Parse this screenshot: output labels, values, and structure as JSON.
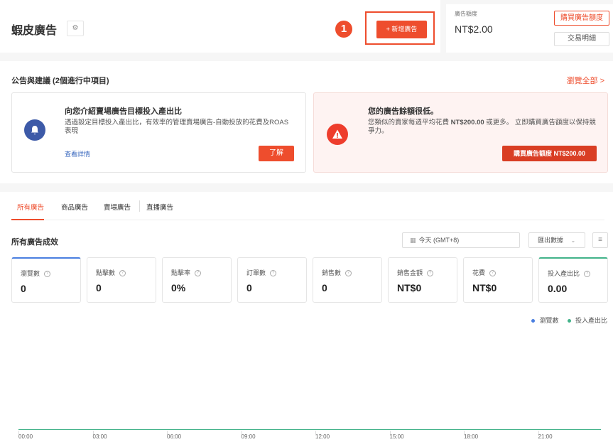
{
  "header": {
    "title": "蝦皮廣告",
    "gear_icon": "gear-icon",
    "step_number": "1",
    "create_button": "+ 新增廣告"
  },
  "budget": {
    "label": "廣告額度",
    "value": "NT$2.00",
    "buy_button": "購買廣告額度",
    "transactions_button": "交易明細"
  },
  "announcements": {
    "title": "公告與建議 (2個進行中項目)",
    "view_all": "瀏覽全部 >",
    "cards": [
      {
        "icon": "bell-icon",
        "heading": "向您介紹賣場廣告目標投入產出比",
        "desc": "透過設定目標投入產出比，有效率的管理賣場廣告-自動投放的花費及ROAS表現",
        "link": "查看詳情",
        "button": "了解"
      },
      {
        "icon": "warning-icon",
        "heading": "您的廣告餘額很低。",
        "desc_prefix": "您類似的賣家每週平均花費 ",
        "desc_amount": "NT$200.00",
        "desc_suffix": " 或更多。 立即購買廣告額度以保持競爭力。",
        "button": "購買廣告額度 NT$200.00"
      }
    ]
  },
  "tabs": [
    "所有廣告",
    "商品廣告",
    "賣場廣告",
    "直播廣告"
  ],
  "performance": {
    "title": "所有廣告成效",
    "date_range": "今天 (GMT+8)",
    "export": "匯出數據",
    "metrics": [
      {
        "label": "瀏覽數",
        "value": "0"
      },
      {
        "label": "點擊數",
        "value": "0"
      },
      {
        "label": "點擊率",
        "value": "0%"
      },
      {
        "label": "訂單數",
        "value": "0"
      },
      {
        "label": "銷售數",
        "value": "0"
      },
      {
        "label": "銷售金額",
        "value": "NT$0"
      },
      {
        "label": "花費",
        "value": "NT$0"
      },
      {
        "label": "投入產出比",
        "value": "0.00"
      }
    ],
    "legend": [
      {
        "name": "瀏覽數",
        "color": "#4a7fe0"
      },
      {
        "name": "投入產出比",
        "color": "#42b38a"
      }
    ]
  },
  "chart_data": {
    "type": "line",
    "x": [
      "00:00",
      "03:00",
      "06:00",
      "09:00",
      "12:00",
      "15:00",
      "18:00",
      "21:00"
    ],
    "series": [
      {
        "name": "瀏覽數",
        "values": [
          0,
          0,
          0,
          0,
          0,
          0,
          0,
          0
        ]
      },
      {
        "name": "投入產出比",
        "values": [
          0,
          0,
          0,
          0,
          0,
          0,
          0,
          0
        ]
      }
    ]
  },
  "colors": {
    "accent": "#ee4d2d",
    "blue": "#4a7fe0",
    "green": "#42b38a"
  }
}
